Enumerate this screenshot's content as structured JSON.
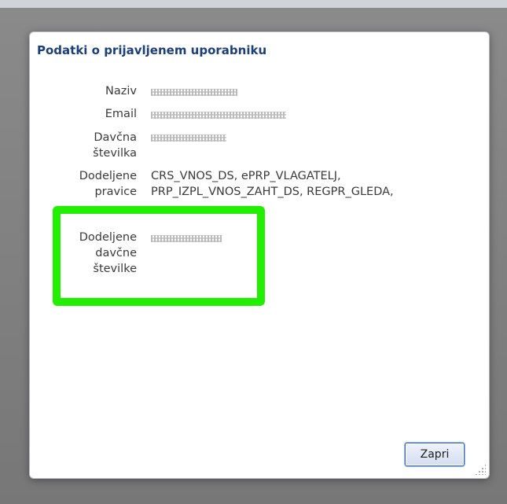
{
  "dialog": {
    "title": "Podatki o prijavljenem uporabniku",
    "fields": [
      {
        "label": "Naziv",
        "value": ""
      },
      {
        "label": "Email",
        "value": ""
      },
      {
        "label_line1": "Davčna",
        "label_line2": "številka",
        "value": ""
      },
      {
        "label_line1": "Dodeljene",
        "label_line2": "pravice",
        "value_line1": "CRS_VNOS_DS, ePRP_VLAGATELJ,",
        "value_line2": "PRP_IZPL_VNOS_ZAHT_DS, REGPR_GLEDA,"
      },
      {
        "label_line1": "Dodeljene",
        "label_line2": "davčne",
        "label_line3": "številke",
        "value": ""
      }
    ],
    "close_button": {
      "label": "Zapri",
      "accesskey": "Z"
    }
  },
  "colors": {
    "title": "#1b3f78",
    "highlight": "#22ee00",
    "backdrop": "#7b7b7b",
    "button_border": "#3c6eb4"
  }
}
